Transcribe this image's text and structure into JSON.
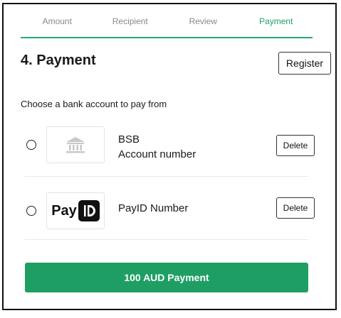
{
  "stepper": {
    "steps": [
      {
        "label": "Amount",
        "active": false
      },
      {
        "label": "Recipient",
        "active": false
      },
      {
        "label": "Review",
        "active": false
      },
      {
        "label": "Payment",
        "active": true
      }
    ],
    "active_color": "#1f9e63"
  },
  "header": {
    "title": "4. Payment",
    "register_label": "Register"
  },
  "subtitle": "Choose a bank account to pay from",
  "accounts": [
    {
      "icon": "bank-icon",
      "line1": "BSB",
      "line2": "Account number",
      "delete_label": "Delete",
      "selected": false
    },
    {
      "logo_text": "Pay",
      "line1": "PayID Number",
      "delete_label": "Delete",
      "selected": false
    }
  ],
  "pay_button": {
    "label": "100 AUD Payment",
    "color": "#1f9e63"
  }
}
